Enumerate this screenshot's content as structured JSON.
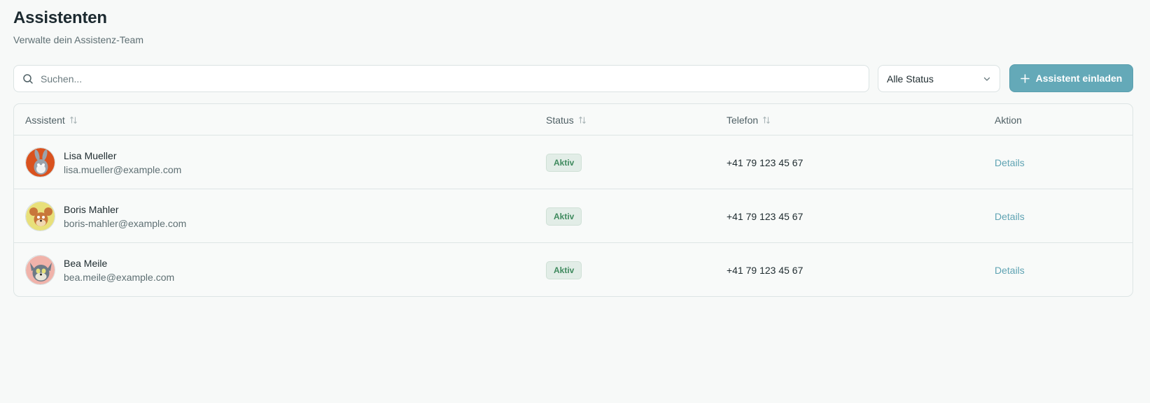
{
  "header": {
    "title": "Assistenten",
    "subtitle": "Verwalte dein Assistenz-Team"
  },
  "toolbar": {
    "search_placeholder": "Suchen...",
    "status_filter_value": "Alle Status",
    "invite_label": "Assistent einladen"
  },
  "table": {
    "columns": {
      "assistant": "Assistent",
      "status": "Status",
      "phone": "Telefon",
      "action": "Aktion"
    },
    "rows": [
      {
        "name": "Lisa Mueller",
        "email": "lisa.mueller@example.com",
        "status": "Aktiv",
        "phone": "+41 79 123 45 67",
        "action": "Details"
      },
      {
        "name": "Boris Mahler",
        "email": "boris-mahler@example.com",
        "status": "Aktiv",
        "phone": "+41 79 123 45 67",
        "action": "Details"
      },
      {
        "name": "Bea Meile",
        "email": "bea.meile@example.com",
        "status": "Aktiv",
        "phone": "+41 79 123 45 67",
        "action": "Details"
      }
    ]
  },
  "colors": {
    "accent": "#64a9b8",
    "status_active_bg": "#e2ede7",
    "status_active_text": "#3f8a5e",
    "link": "#5fa3b3"
  },
  "icons": {
    "search": "search-icon",
    "select": "chevron-down-icon",
    "invite": "plus-icon",
    "sort": "sort-icon"
  }
}
